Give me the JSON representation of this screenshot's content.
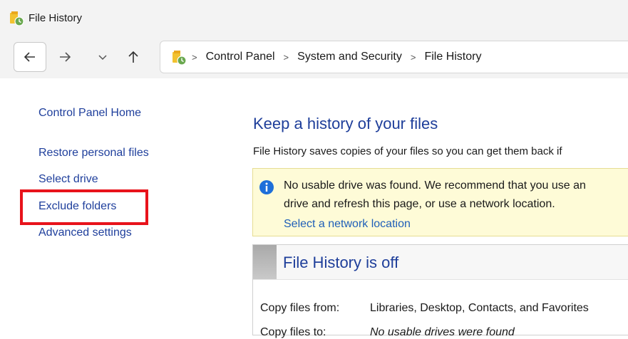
{
  "window": {
    "title": "File History"
  },
  "nav": {
    "breadcrumbs": [
      "Control Panel",
      "System and Security",
      "File History"
    ],
    "separator": ">"
  },
  "sidebar": {
    "items": [
      {
        "label": "Control Panel Home"
      },
      {
        "label": "Restore personal files"
      },
      {
        "label": "Select drive"
      },
      {
        "label": "Exclude folders"
      },
      {
        "label": "Advanced settings"
      }
    ],
    "highlight_color": "#e8131b"
  },
  "main": {
    "heading": "Keep a history of your files",
    "description": "File History saves copies of your files so you can get them back if",
    "info": {
      "line1": "No usable drive was found. We recommend that you use an",
      "line2": "drive and refresh this page, or use a network location.",
      "link": "Select a network location"
    },
    "status": {
      "title": "File History is off",
      "rows": [
        {
          "label": "Copy files from:",
          "value": "Libraries, Desktop, Contacts, and Favorites"
        },
        {
          "label": "Copy files to:",
          "value": "No usable drives were found"
        }
      ]
    }
  },
  "colors": {
    "link": "#1f3f9c",
    "heading": "#1e3e9a",
    "info_bg": "#fefbd7",
    "chrome_bg": "#f3f3f3"
  },
  "icons": {
    "app": "file-history-icon",
    "back": "arrow-left-icon",
    "forward": "arrow-right-icon",
    "recent": "chevron-down-icon",
    "up": "arrow-up-icon",
    "info": "info-icon"
  }
}
